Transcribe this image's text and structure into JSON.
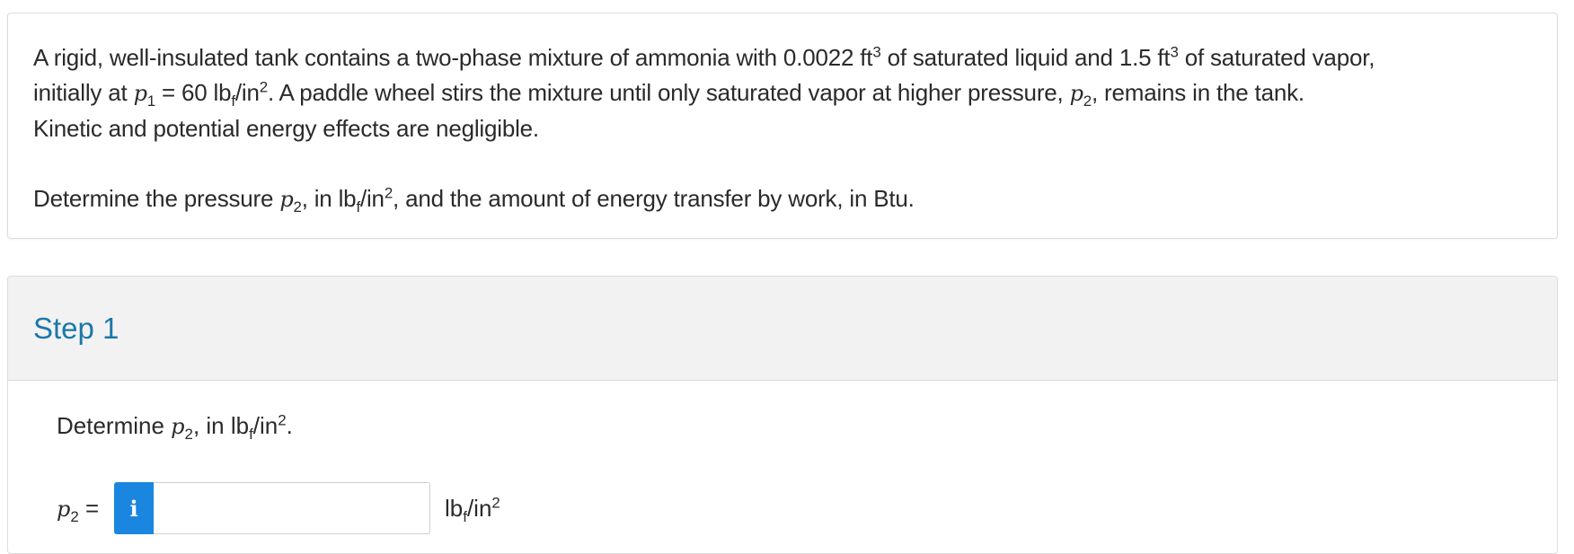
{
  "question": {
    "line1": {
      "part_a": "A rigid, well-insulated tank contains a two-phase mixture of ammonia with 0.0022 ft",
      "sup_a": "3",
      "part_b": " of saturated liquid and 1.5 ft",
      "sup_b": "3",
      "part_c": " of saturated vapor,"
    },
    "line2": {
      "part_a": "initially at ",
      "var_p": "p",
      "sub_1": "1",
      "part_b": " = 60 lb",
      "sub_f": "f",
      "part_c": "/in",
      "sup_2": "2",
      "part_d": ".  A paddle wheel stirs the mixture until only saturated vapor at higher pressure, ",
      "var_p2": "p",
      "sub_2": "2",
      "part_e": ", remains in the tank."
    },
    "line3": "Kinetic and potential energy effects are negligible.",
    "line4": {
      "part_a": "Determine the pressure ",
      "var_p": "p",
      "sub_2": "2",
      "part_b": ", in lb",
      "sub_f": "f",
      "part_c": "/in",
      "sup_2": "2",
      "part_d": ", and the amount of energy transfer by work, in Btu."
    }
  },
  "step": {
    "title": "Step 1",
    "prompt": {
      "part_a": "Determine ",
      "var_p": "p",
      "sub_2": "2",
      "part_b": ", in lb",
      "sub_f": "f",
      "part_c": "/in",
      "sup_2": "2",
      "part_d": "."
    },
    "answer": {
      "label_var": "p",
      "label_sub": "2",
      "label_eq": " =",
      "info_glyph": "i",
      "input_value": "",
      "unit_a": "lb",
      "unit_sub": "f",
      "unit_b": "/in",
      "unit_sup": "2"
    }
  },
  "colors": {
    "accent": "#1b78a8",
    "info_button": "#1a86e0",
    "header_bg": "#f2f2f2"
  }
}
